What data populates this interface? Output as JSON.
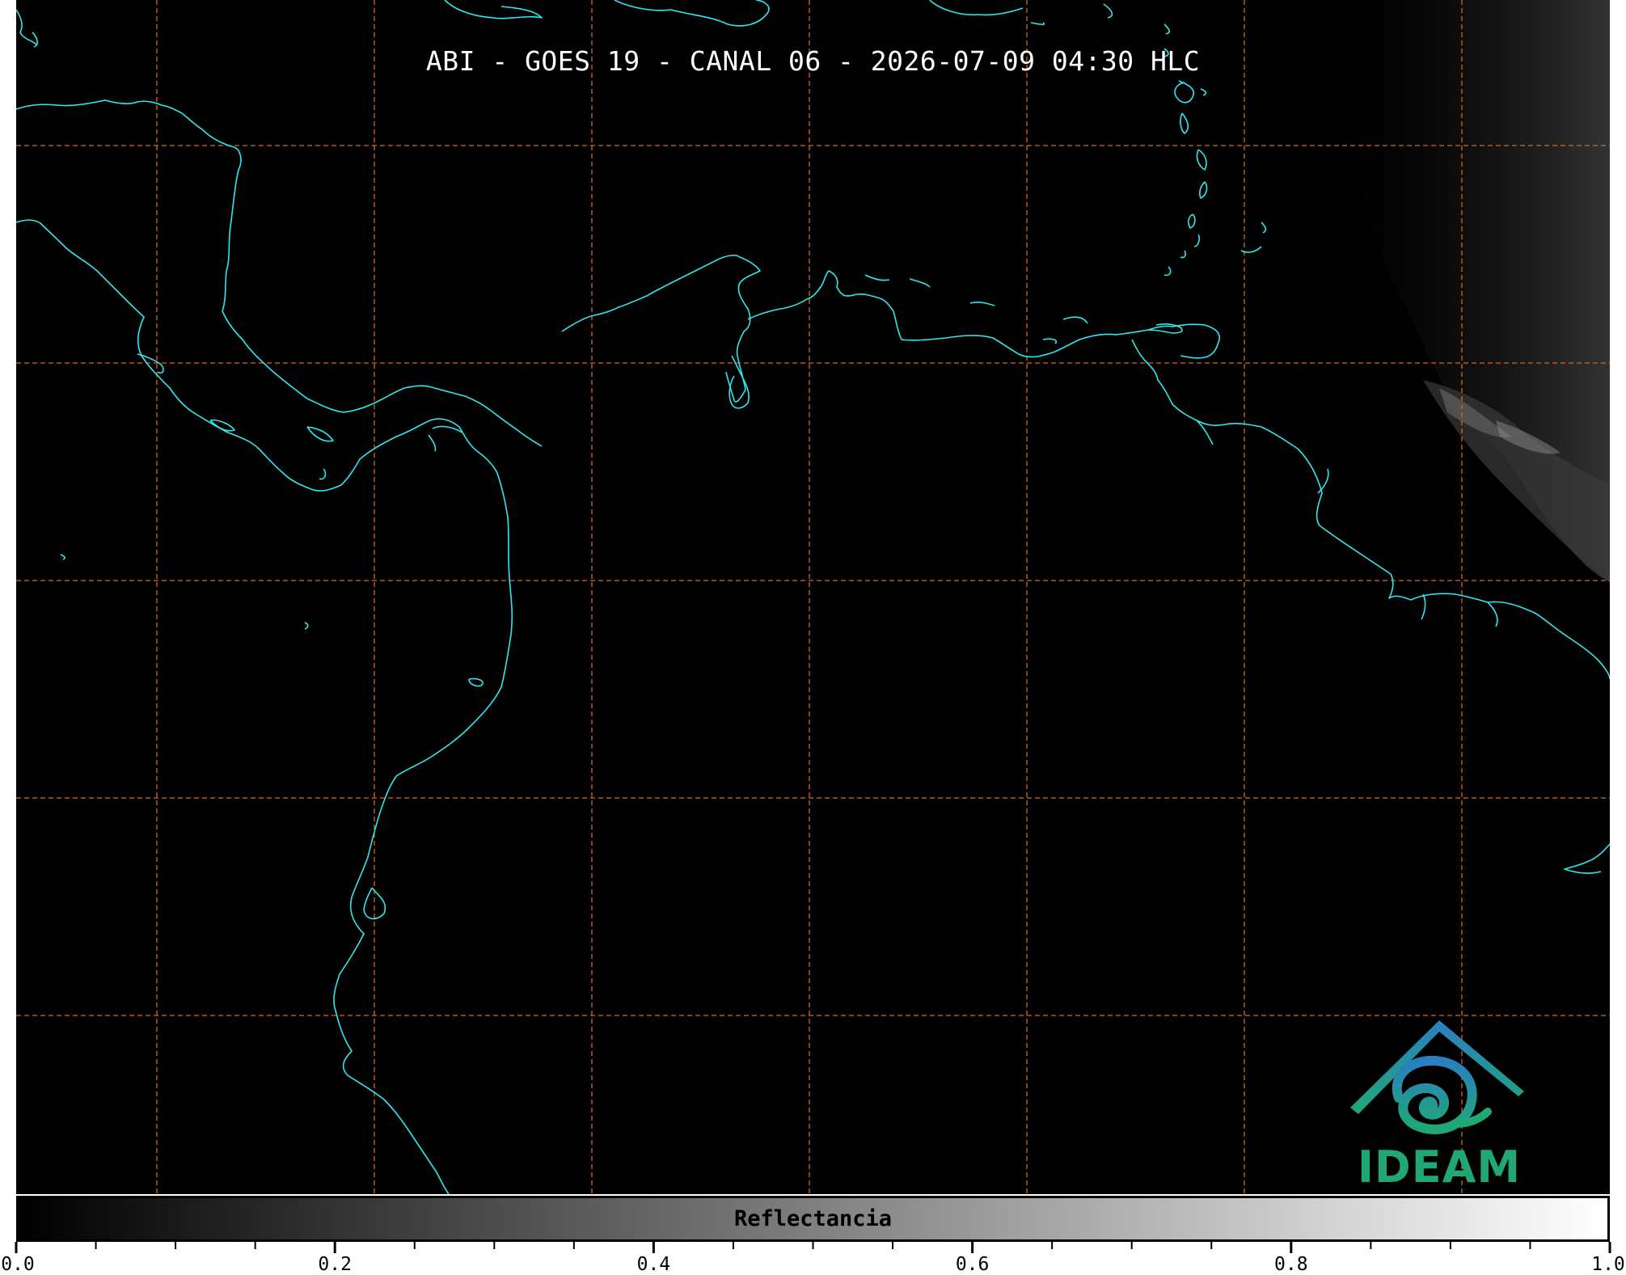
{
  "title": "ABI - GOES 19 - CANAL 06 - 2026-07-09 04:30 HLC",
  "colors": {
    "background": "#000000",
    "coastline": "#2fe8ee",
    "gridline": "#d2691e",
    "title_text": "#ffffff",
    "logo_green": "#1fa876",
    "logo_blue": "#2a7fc1"
  },
  "logo": {
    "text": "IDEAM",
    "icon": "ideam-mountain-spiral-icon"
  },
  "colorbar": {
    "label": "Reflectancia",
    "colormap": "greyscale black-to-white",
    "range": [
      0.0,
      1.0
    ],
    "tick_labels": [
      "0.0",
      "0.2",
      "0.4",
      "0.6",
      "0.8",
      "1.0"
    ],
    "major_ticks": [
      0.0,
      0.2,
      0.4,
      0.6,
      0.8,
      1.0
    ],
    "minor_tick_step": 0.05
  },
  "map": {
    "gridlines": "dashed",
    "cloud_region": "northeast corner, grey cloud field"
  }
}
